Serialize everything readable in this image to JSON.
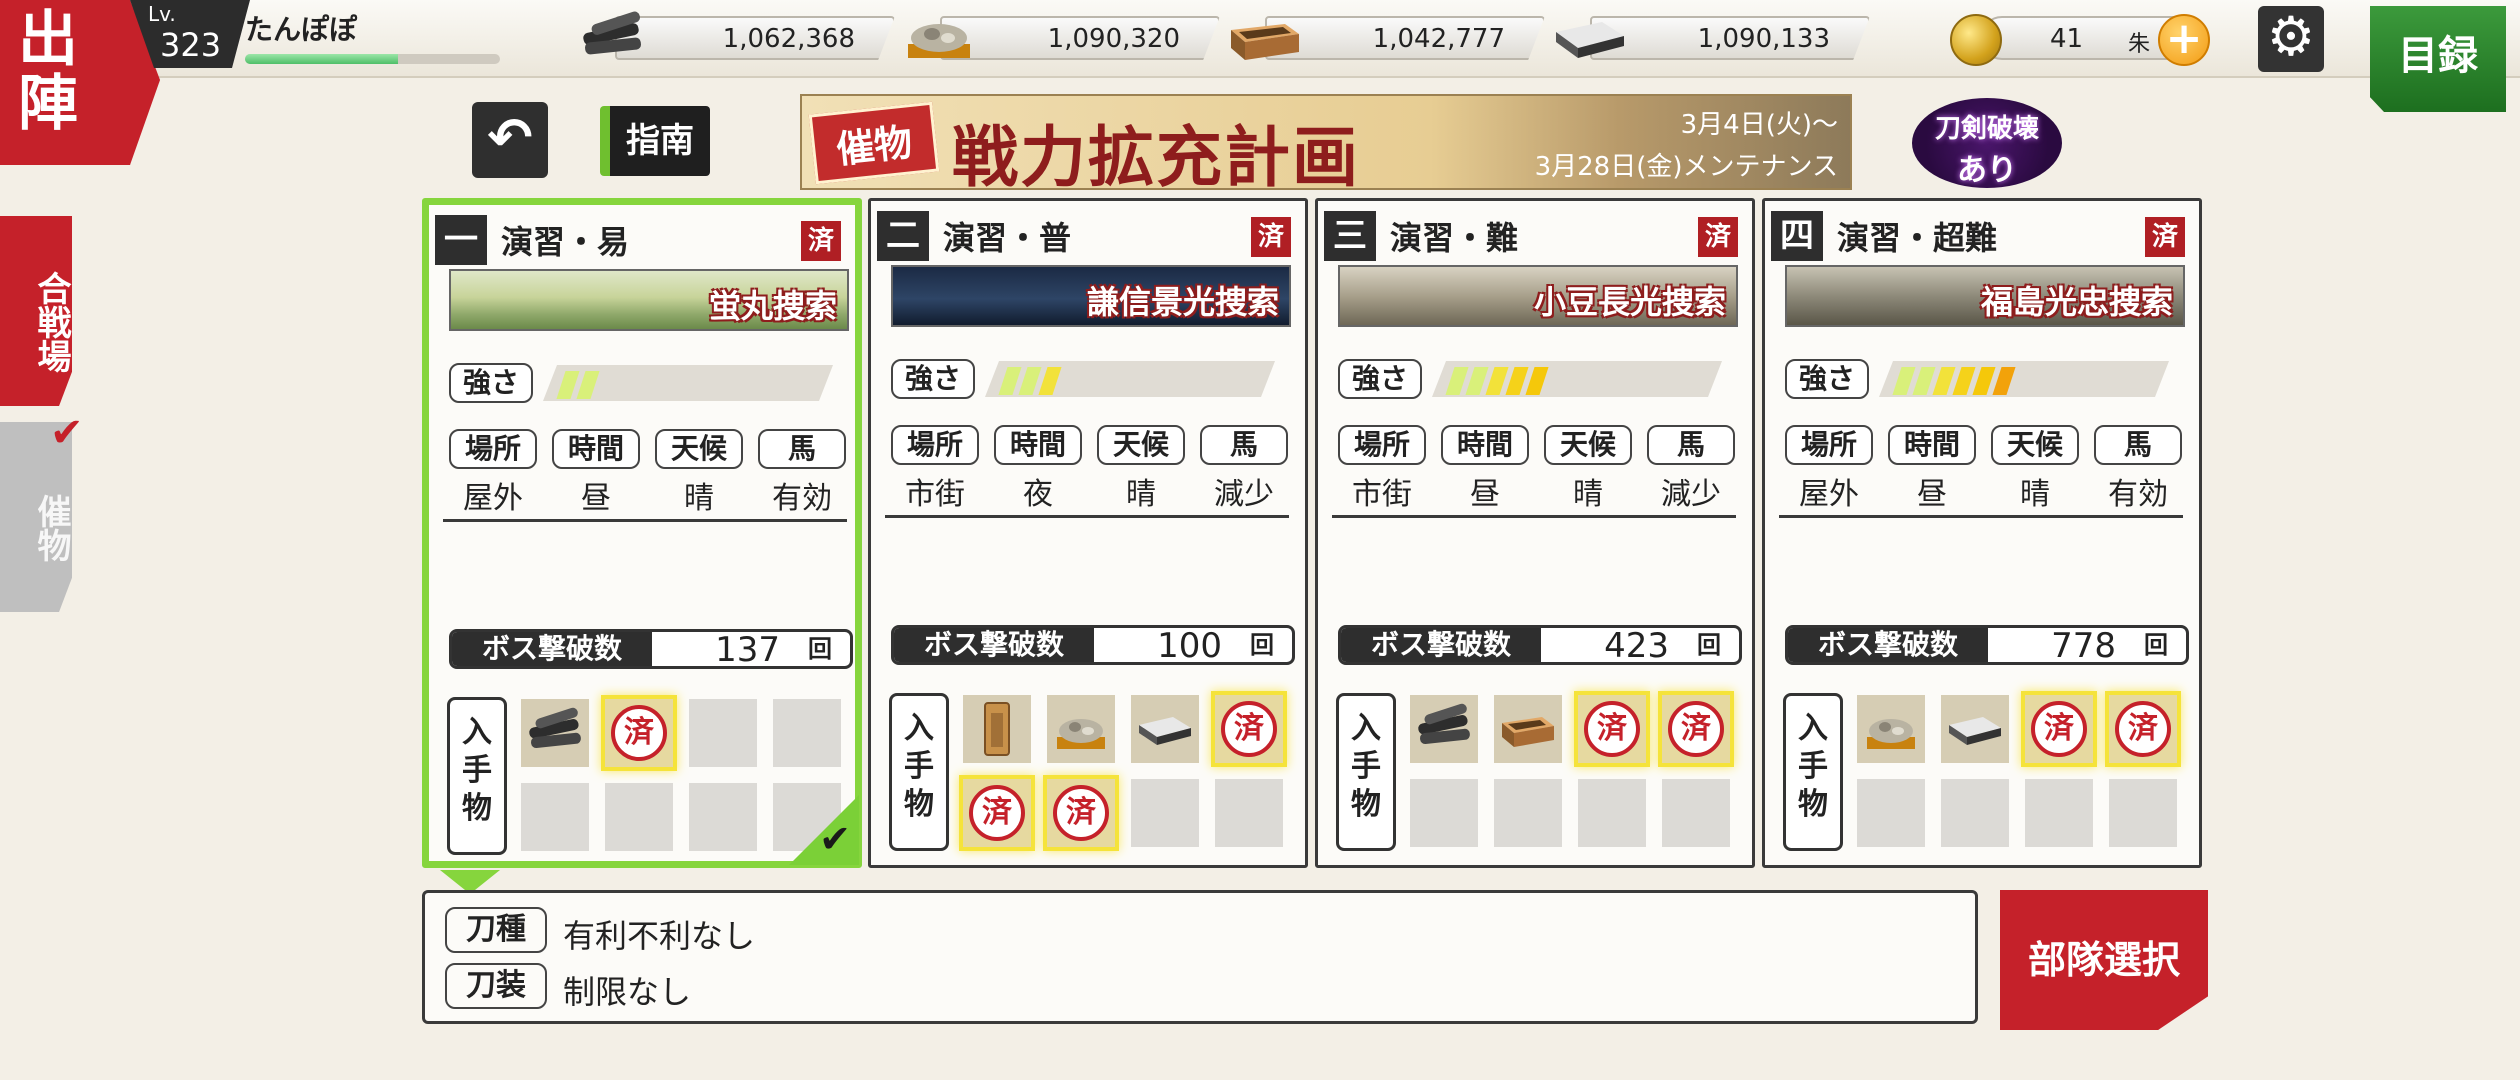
{
  "header": {
    "deploy_label": "出陣",
    "level_prefix": "Lv.",
    "level": "323",
    "player_name": "たんぽぽ",
    "exp_progress_fraction": 0.6,
    "resources": [
      {
        "name": "charcoal",
        "icon": "charcoal-icon",
        "value": "1,062,368"
      },
      {
        "name": "steel",
        "icon": "tamahagane-icon",
        "value": "1,090,320"
      },
      {
        "name": "cooling-material",
        "icon": "cooling-material-icon",
        "value": "1,042,777"
      },
      {
        "name": "whetstone",
        "icon": "whetstone-icon",
        "value": "1,090,133"
      }
    ],
    "koban_value": "41",
    "koban_unit": "朱",
    "catalog_label": "目録"
  },
  "sidebar": {
    "tabs": [
      {
        "label": "合戦場",
        "active": false
      },
      {
        "label": "催物",
        "active": true
      }
    ]
  },
  "toolbar": {
    "guide_label": "指南"
  },
  "banner": {
    "tag": "催物",
    "title": "戦力拡充計画",
    "date_line1": "3月4日(火)〜",
    "date_line2": "3月28日(金)メンテナンス",
    "break_badge_line1": "刀剣破壊",
    "break_badge_line2": "あり"
  },
  "labels": {
    "strength": "強さ",
    "location": "場所",
    "time": "時間",
    "weather": "天候",
    "horse": "馬",
    "boss_kills": "ボス撃破数",
    "times_unit": "回",
    "obtainable": "入手物",
    "cleared": "済"
  },
  "cards": [
    {
      "num": "一",
      "title": "演習・易",
      "search": "蛍丸捜索",
      "strength_level": 2,
      "location": "屋外",
      "time": "昼",
      "weather": "晴",
      "horse": "有効",
      "boss_count": "137",
      "selected": true,
      "items_row1": [
        "charcoal-icon",
        "cleared-stamp",
        "",
        "",
        ""
      ],
      "items_row2": [
        "",
        "",
        "",
        ""
      ]
    },
    {
      "num": "二",
      "title": "演習・普",
      "search": "謙信景光捜索",
      "strength_level": 3,
      "location": "市街",
      "time": "夜",
      "weather": "晴",
      "horse": "減少",
      "boss_count": "100",
      "selected": false,
      "items_row1": [
        "tag-icon",
        "tamahagane-icon",
        "whetstone-icon",
        "cleared-stamp"
      ],
      "items_row2": [
        "cleared-stamp",
        "cleared-stamp",
        "",
        ""
      ]
    },
    {
      "num": "三",
      "title": "演習・難",
      "search": "小豆長光捜索",
      "strength_level": 5,
      "location": "市街",
      "time": "昼",
      "weather": "晴",
      "horse": "減少",
      "boss_count": "423",
      "selected": false,
      "items_row1": [
        "charcoal-icon",
        "cooling-material-icon",
        "cleared-stamp",
        "cleared-stamp"
      ],
      "items_row2": [
        "",
        "",
        "",
        ""
      ]
    },
    {
      "num": "四",
      "title": "演習・超難",
      "search": "福島光忠捜索",
      "strength_level": 6,
      "location": "屋外",
      "time": "昼",
      "weather": "晴",
      "horse": "有効",
      "boss_count": "778",
      "selected": false,
      "items_row1": [
        "tamahagane-icon",
        "whetstone-icon",
        "cleared-stamp",
        "cleared-stamp"
      ],
      "items_row2": [
        "",
        "",
        "",
        ""
      ]
    }
  ],
  "info": {
    "sword_type_label": "刀種",
    "sword_type_value": "有利不利なし",
    "equipment_label": "刀装",
    "equipment_value": "制限なし"
  },
  "form_team_label": "部隊選択",
  "colors": {
    "accent_red": "#c5212a",
    "selected_green": "#86d53d",
    "catalog_green": "#1d6f1f"
  }
}
